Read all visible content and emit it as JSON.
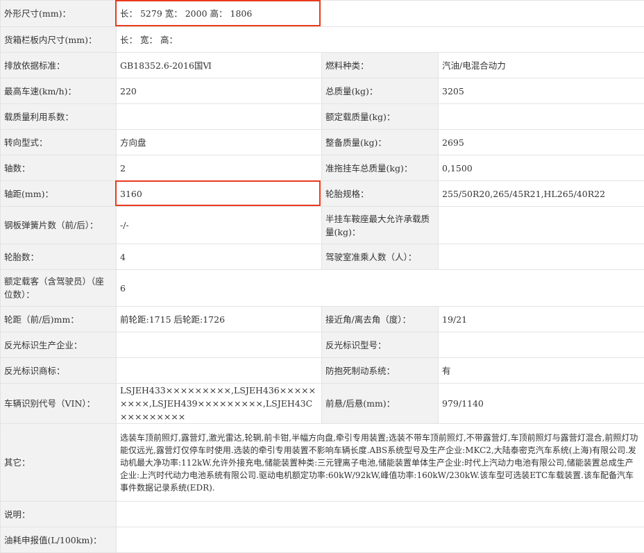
{
  "colors": {
    "highlight": "#e8391d",
    "label_bg": "#f2f2f2",
    "border": "#e3e3e3"
  },
  "rows": {
    "dims": {
      "label": "外形尺寸(mm)：",
      "value": "长：  5279 宽：  2000 高：  1806"
    },
    "cargo": {
      "label": "货箱栏板内尺寸(mm)：",
      "value": "长：  宽：  高："
    },
    "emission": {
      "label": "排放依据标准：",
      "value": "GB18352.6-2016国Ⅵ",
      "label2": "燃料种类：",
      "value2": "汽油/电混合动力"
    },
    "speed": {
      "label": "最高车速(km/h)：",
      "value": "220",
      "label2": "总质量(kg)：",
      "value2": "3205"
    },
    "load_coef": {
      "label": "载质量利用系数：",
      "value": "",
      "label2": "额定载质量(kg)：",
      "value2": ""
    },
    "steering": {
      "label": "转向型式：",
      "value": "方向盘",
      "label2": "整备质量(kg)：",
      "value2": "2695"
    },
    "axles": {
      "label": "轴数：",
      "value": "2",
      "label2": "准拖挂车总质量(kg)：",
      "value2": "0,1500"
    },
    "wheelbase": {
      "label": "轴距(mm)：",
      "value": "3160",
      "label2": "轮胎规格：",
      "value2": "255/50R20,265/45R21,HL265/40R22"
    },
    "springs": {
      "label": "钢板弹簧片数（前/后）：",
      "value": "-/-",
      "label2": "半挂车鞍座最大允许承载质量(kg)：",
      "value2": ""
    },
    "tires": {
      "label": "轮胎数：",
      "value": "4",
      "label2": "驾驶室准乘人数（人）：",
      "value2": ""
    },
    "seats": {
      "label": "额定载客（含驾驶员）（座位数）：",
      "value": "6"
    },
    "track": {
      "label": "轮距（前/后)mm：",
      "value": "前轮距:1715 后轮距:1726",
      "label2": "接近角/离去角（度）：",
      "value2": "19/21"
    },
    "reflect_mfr": {
      "label": "反光标识生产企业：",
      "value": "",
      "label2": "反光标识型号：",
      "value2": ""
    },
    "reflect_mark": {
      "label": "反光标识商标：",
      "value": "",
      "label2": "防抱死制动系统：",
      "value2": "有"
    },
    "vin": {
      "label": "车辆识别代号（VIN）：",
      "value": "LSJEH433×××××××××,LSJEH436×××××××××,LSJEH439×××××××××,LSJEH43C×××××××××",
      "label2": "前悬/后悬(mm)：",
      "value2": "979/1140"
    },
    "other": {
      "label": "其它：",
      "value": "选装车顶前照灯,露营灯,激光雷达,轮辋,前卡钳,半幅方向盘,牵引专用装置;选装不带车顶前照灯,不带露营灯,车顶前照灯与露营灯混合,前照灯功能仅远光,露营灯仅停车时使用.选装的牵引专用装置不影响车辆长度.ABS系统型号及生产企业:MKC2,大陆泰密克汽车系统(上海)有限公司.发动机最大净功率:112kW.允许外接充电,储能装置种类:三元锂离子电池,储能装置单体生产企业:时代上汽动力电池有限公司,储能装置总成生产企业:上汽时代动力电池系统有限公司.驱动电机额定功率:60kW/92kW,峰值功率:160kW/230kW.该车型可选装ETC车载装置.该车配备汽车事件数据记录系统(EDR)."
    },
    "note": {
      "label": "说明：",
      "value": ""
    },
    "fuel": {
      "label": "油耗申报值(L/100km)：",
      "value": ""
    }
  }
}
